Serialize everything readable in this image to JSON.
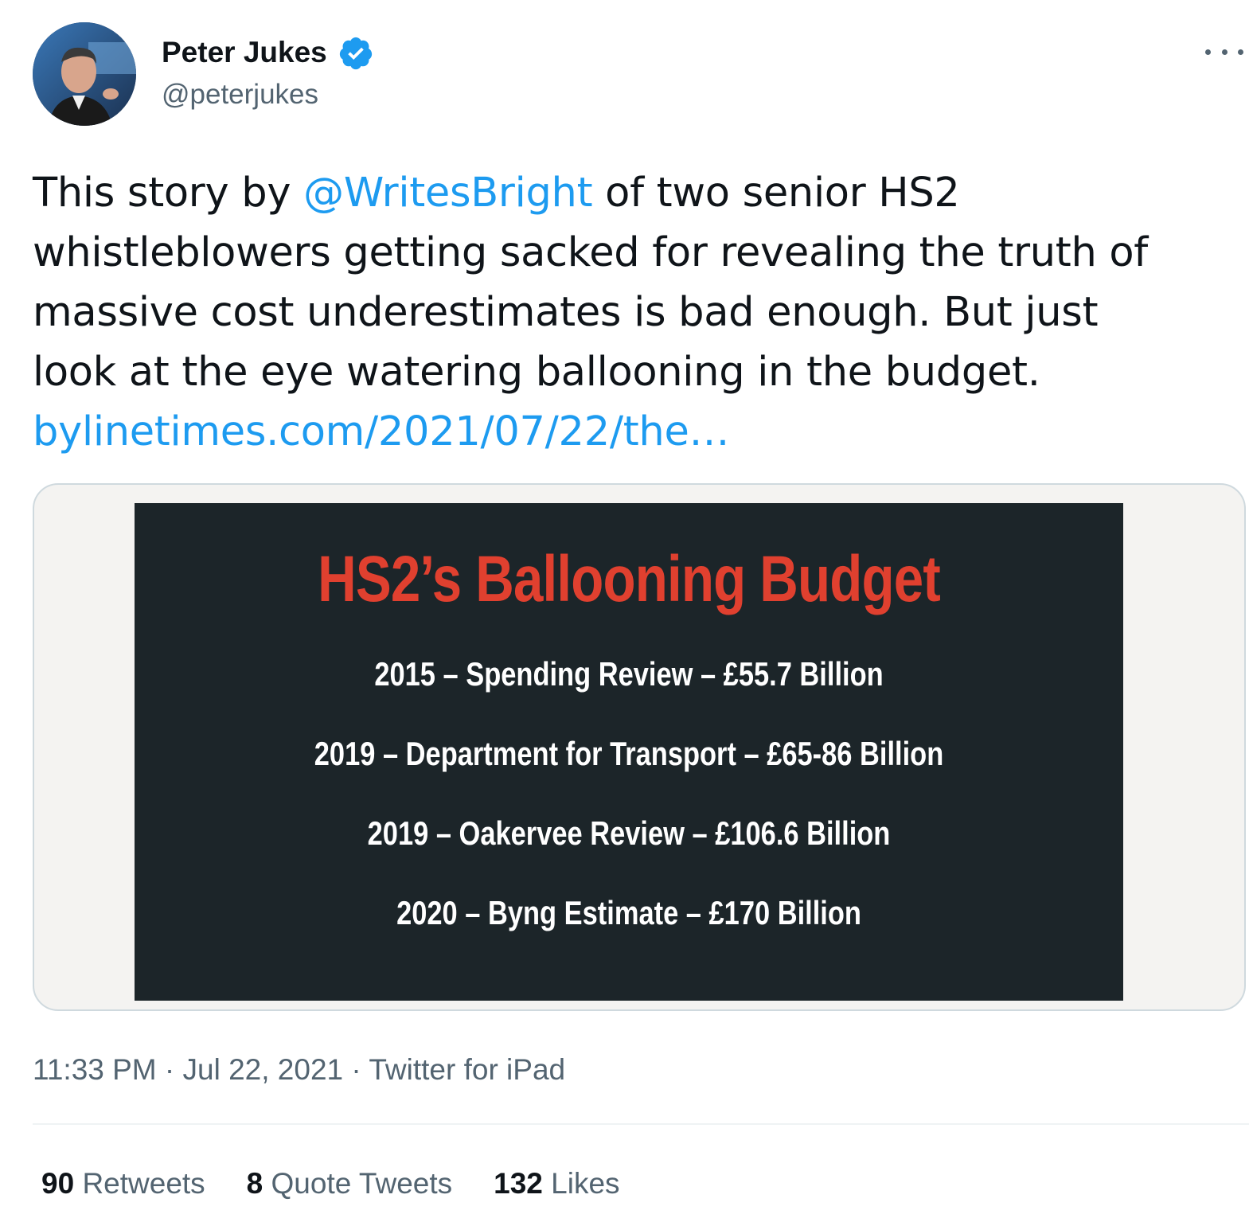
{
  "author": {
    "name": "Peter Jukes",
    "handle": "@peterjukes",
    "verified": true
  },
  "tweet": {
    "lines": [
      {
        "before": "This story by ",
        "mention": "@WritesBright",
        "after": " of two senior HS2"
      },
      {
        "text": "whistleblowers getting sacked for revealing the truth of"
      },
      {
        "text": "massive cost underestimates is bad enough. But just"
      },
      {
        "text": "look at the eye watering ballooning in the budget."
      }
    ],
    "link": "bylinetimes.com/2021/07/22/the…"
  },
  "media": {
    "title": "HS2’s Ballooning Budget",
    "rows": [
      "2015 – Spending Review – £55.7 Billion",
      "2019 – Department for Transport – £65-86 Billion",
      "2019 – Oakervee Review – £106.6 Billion",
      "2020 – Byng Estimate – £170 Billion"
    ]
  },
  "meta": {
    "time": "11:33 PM",
    "separator": " · ",
    "date": "Jul 22, 2021",
    "source": "Twitter for iPad"
  },
  "stats": {
    "retweets_count": "90",
    "retweets_label": "Retweets",
    "quotes_count": "8",
    "quotes_label": "Quote Tweets",
    "likes_count": "132",
    "likes_label": "Likes"
  },
  "colors": {
    "link": "#1d9bf0",
    "title_red": "#e0402f",
    "slide_bg": "#1c2529",
    "secondary_text": "#536471"
  }
}
